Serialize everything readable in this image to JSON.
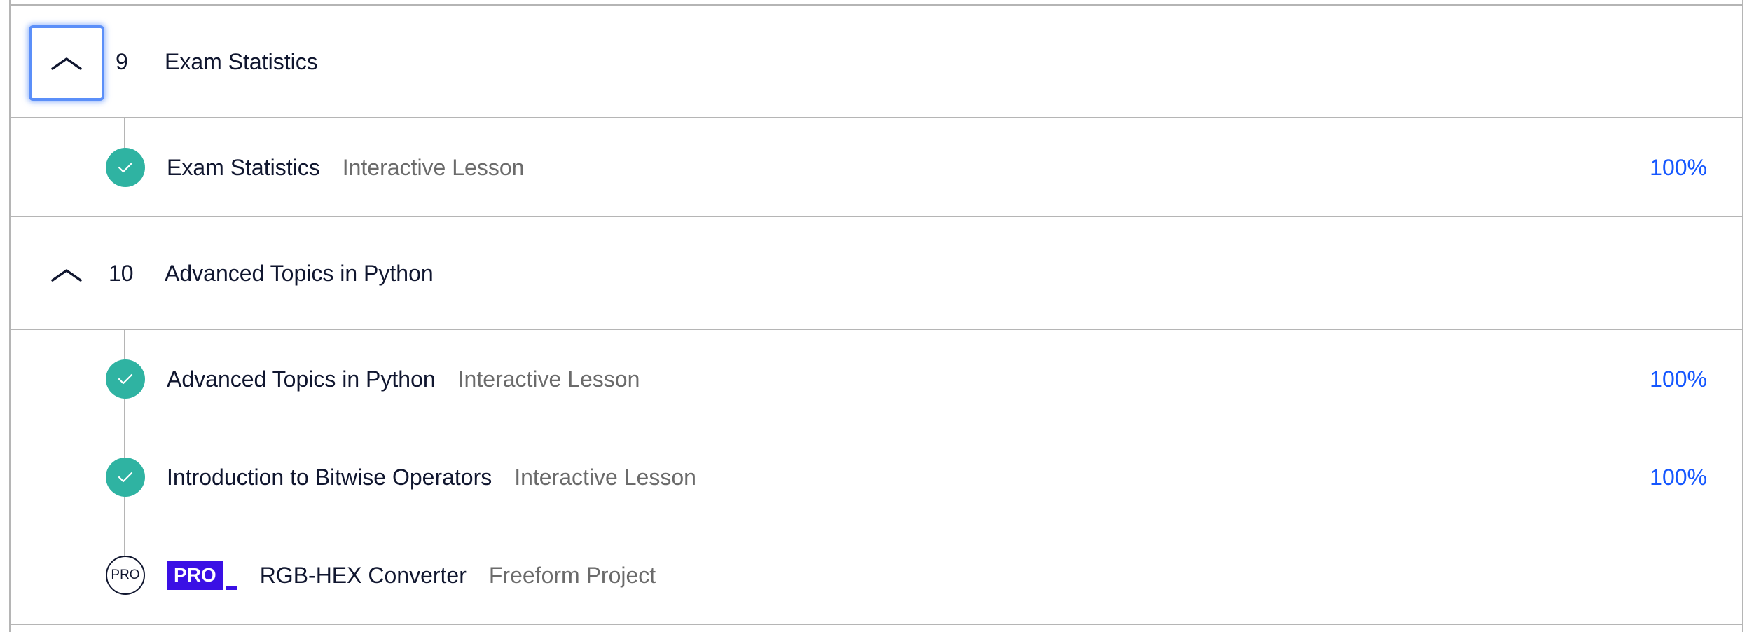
{
  "modules": [
    {
      "number": "9",
      "title": "Exam Statistics",
      "lessons": [
        {
          "title": "Exam Statistics",
          "type": "Interactive Lesson",
          "progress": "100%",
          "status": "completed",
          "status_icon": "check-icon"
        }
      ]
    },
    {
      "number": "10",
      "title": "Advanced Topics in Python",
      "lessons": [
        {
          "title": "Advanced Topics in Python",
          "type": "Interactive Lesson",
          "progress": "100%",
          "status": "completed",
          "status_icon": "check-icon"
        },
        {
          "title": "Introduction to Bitwise Operators",
          "type": "Interactive Lesson",
          "progress": "100%",
          "status": "completed",
          "status_icon": "check-icon"
        },
        {
          "title": "RGB-HEX Converter",
          "type": "Freeform Project",
          "badge": "PRO",
          "status": "locked-pro",
          "status_label": "PRO"
        }
      ]
    }
  ],
  "colors": {
    "completed": "#2fb3a2",
    "progress_text": "#1557ff",
    "pro_badge": "#3a10e5",
    "divider": "#b5b5b5",
    "focus_ring": "#5b8ff9"
  }
}
